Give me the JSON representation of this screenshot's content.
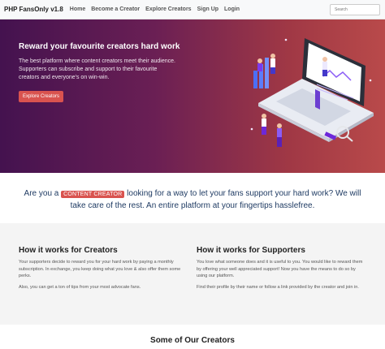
{
  "navbar": {
    "brand": "PHP FansOnly v1.8",
    "links": [
      "Home",
      "Become a Creator",
      "Explore Creators",
      "Sign Up",
      "Login"
    ],
    "search_placeholder": "Search"
  },
  "hero": {
    "title": "Reward your favourite creators hard work",
    "text": "The best platform where content creators meet their audience. Supporters can subscribe and support to their favourite creators and everyone's on win-win.",
    "button_label": "Explore Creators"
  },
  "tagline": {
    "before": "Are you a",
    "badge": "CONTENT CREATOR",
    "after": "looking for a way to let your fans support your hard work? We will take care of the rest. An entire platform at your fingertips hasslefree."
  },
  "how": {
    "creators": {
      "title": "How it works for Creators",
      "p1": "Your supporters decide to reward you for your hard work by paying a monthly subscription. In exchange, you keep doing what you love & also offer them some perks.",
      "p2": "Also, you can get a ton of tips from your most advocate fans."
    },
    "supporters": {
      "title": "How it works for Supporters",
      "p1": "You love what someone does and it is useful to you. You would like to reward them by offering your well appreciated support! Now you have the means to do so by using our platform.",
      "p2": "Find their profile by their name or follow a link provided by the creator and join in."
    }
  },
  "creators_section_title": "Some of Our Creators",
  "colors": {
    "gradient_start": "#44124f",
    "gradient_end": "#b94a4a",
    "accent": "#d9534f",
    "tagline_text": "#1f3b63"
  }
}
